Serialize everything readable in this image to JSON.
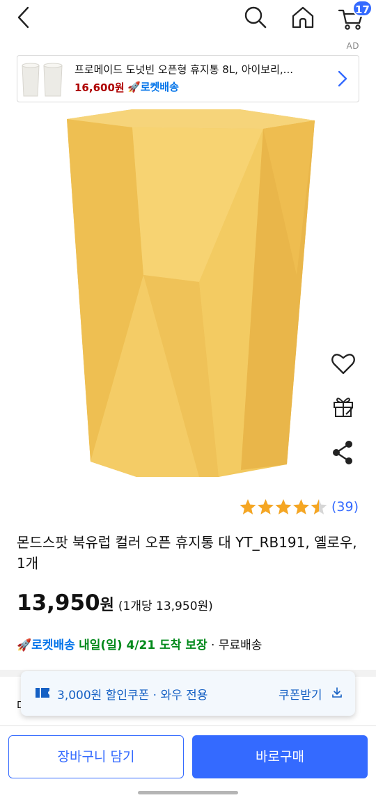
{
  "header": {
    "cart_badge": "17",
    "icons": [
      "back-arrow-icon",
      "search-icon",
      "home-icon",
      "cart-icon"
    ]
  },
  "ad": {
    "label": "AD",
    "title": "프로메이드 도넛빈 오픈형 휴지통 8L, 아이보리,...",
    "price": "16,600원",
    "rocket_label": "로켓배송"
  },
  "product": {
    "rating_value": 4.5,
    "rating_stars_max": 5,
    "review_count": "(39)",
    "title": "몬드스팟 북유럽 컬러 오픈 휴지통 대 YT_RB191, 옐로우, 1개",
    "price": "13,950",
    "currency": "원",
    "unit_price": "(1개당 13,950원)",
    "image_color": "#f0c85c"
  },
  "delivery": {
    "rocket": "로켓배송",
    "arrival": "내일(일) 4/21 도착 보장",
    "separator": "·",
    "free": "무료배송"
  },
  "coupon": {
    "text": "3,000원 할인쿠폰 · 와우 전용",
    "download": "쿠폰받기"
  },
  "partial_text": "다",
  "actions": {
    "add_to_cart": "장바구니 담기",
    "buy_now": "바로구매"
  },
  "colors": {
    "accent": "#346aff",
    "rocket_blue": "#0073e9",
    "arrival_green": "#00891a",
    "ad_price_red": "#ae0000",
    "star": "#f5a623"
  }
}
